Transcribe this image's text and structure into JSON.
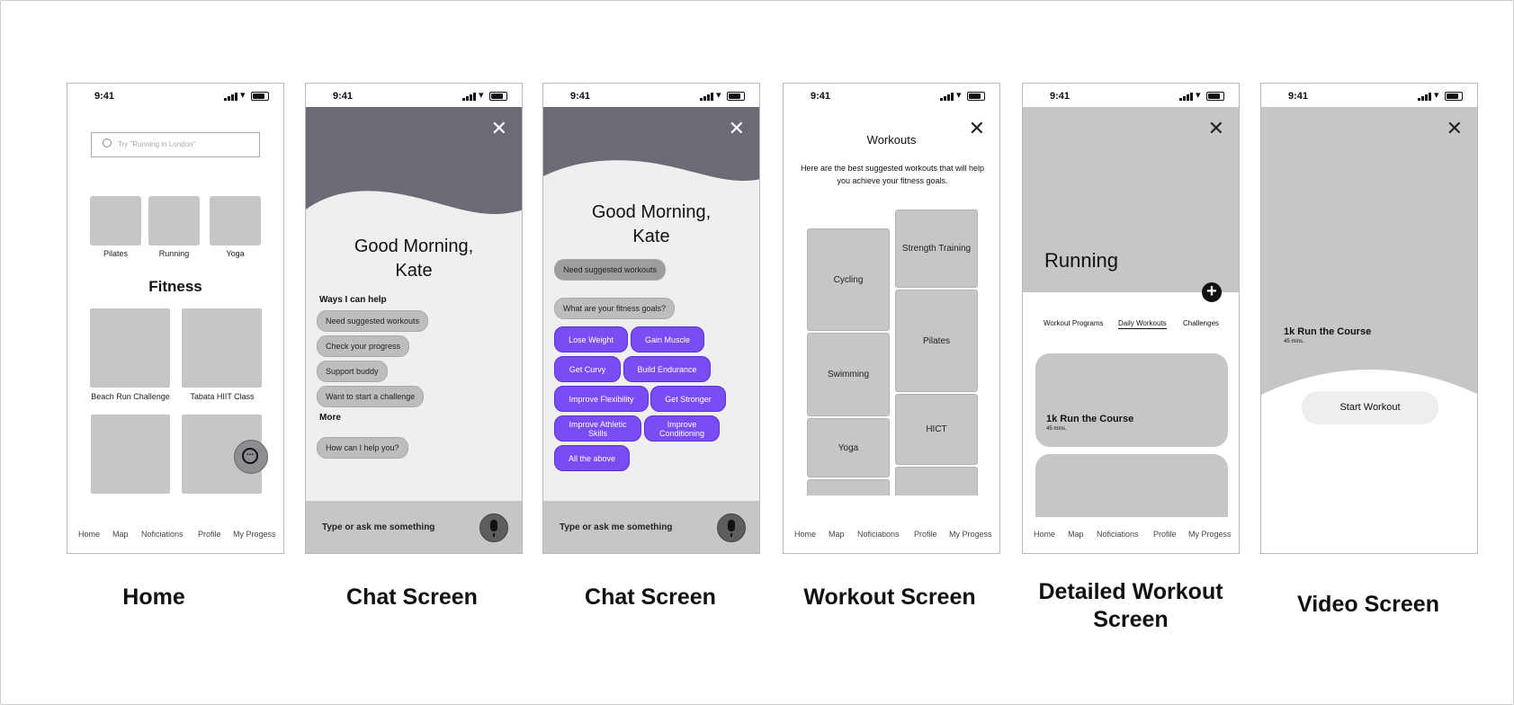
{
  "status_time": "9:41",
  "captions": [
    "Home",
    "Chat Screen",
    "Chat Screen",
    "Workout Screen",
    "Detailed Workout Screen",
    "Video Screen"
  ],
  "nav": [
    "Home",
    "Map",
    "Noficiations",
    "Profile",
    "My Progess"
  ],
  "home": {
    "search_placeholder": "Try \"Running in London\"",
    "categories": [
      "Pilates",
      "Running",
      "Yoga"
    ],
    "section_title": "Fitness",
    "cards": [
      "Beach Run Challenge",
      "Tabata HIIT Class"
    ]
  },
  "chat1": {
    "greeting_line1": "Good Morning,",
    "greeting_line2": "Kate",
    "ways_title": "Ways I can help",
    "options": [
      "Need suggested workouts",
      "Check your progress",
      "Support buddy",
      "Want to start a challenge"
    ],
    "more_title": "More",
    "more_option": "How can I help you?",
    "input_placeholder": "Type or ask me something"
  },
  "chat2": {
    "greeting_line1": "Good Morning,",
    "greeting_line2": "Kate",
    "user_msg": "Need suggested workouts",
    "bot_msg": "What are your fitness goals?",
    "goals": [
      "Lose Weight",
      "Gain Muscle",
      "Get Curvy",
      "Build Endurance",
      "Improve Flexibility",
      "Get Stronger",
      "Improve Athletic Skills",
      "Improve Conditioning",
      "All the above"
    ],
    "input_placeholder": "Type or ask me something"
  },
  "workouts": {
    "title": "Workouts",
    "subtitle": "Here are the best suggested workouts that will help you achieve your fitness goals.",
    "left": [
      "Cycling",
      "Swimming",
      "Yoga"
    ],
    "right": [
      "Strength Training",
      "Pilates",
      "HICT"
    ]
  },
  "detail": {
    "title": "Running",
    "tabs": [
      "Workout Programs",
      "Daily Workouts",
      "Challenges"
    ],
    "card_title": "1k Run the Course",
    "card_meta": "45 mins."
  },
  "video": {
    "title": "1k Run the Course",
    "meta": "45 mins.",
    "button": "Start Workout"
  },
  "colors": {
    "accent": "#7a4cf3",
    "header_dark": "#6c6a74",
    "placeholder_gray": "#c6c6c6"
  }
}
